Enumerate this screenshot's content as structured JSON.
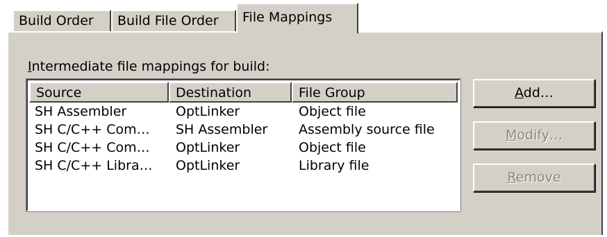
{
  "tabs": [
    {
      "label": "Build Order",
      "active": false
    },
    {
      "label": "Build File Order",
      "active": false
    },
    {
      "label": "File Mappings",
      "active": true
    }
  ],
  "caption": {
    "mnemonic": "I",
    "rest": "ntermediate file mappings for build:"
  },
  "table": {
    "headers": [
      "Source",
      "Destination",
      "File Group"
    ],
    "rows": [
      {
        "source": "SH Assembler",
        "destination": "OptLinker",
        "file_group": "Object file"
      },
      {
        "source": "SH C/C++ Com…",
        "destination": "SH Assembler",
        "file_group": "Assembly source file"
      },
      {
        "source": "SH C/C++ Com…",
        "destination": "OptLinker",
        "file_group": "Object file"
      },
      {
        "source": "SH C/C++ Libra…",
        "destination": "OptLinker",
        "file_group": "Library file"
      }
    ]
  },
  "buttons": {
    "add": {
      "mnemonic": "A",
      "rest": "dd…",
      "enabled": true
    },
    "modify": {
      "mnemonic": "M",
      "rest": "odify…",
      "enabled": false
    },
    "remove": {
      "mnemonic": "R",
      "rest": "emove",
      "enabled": false
    }
  }
}
